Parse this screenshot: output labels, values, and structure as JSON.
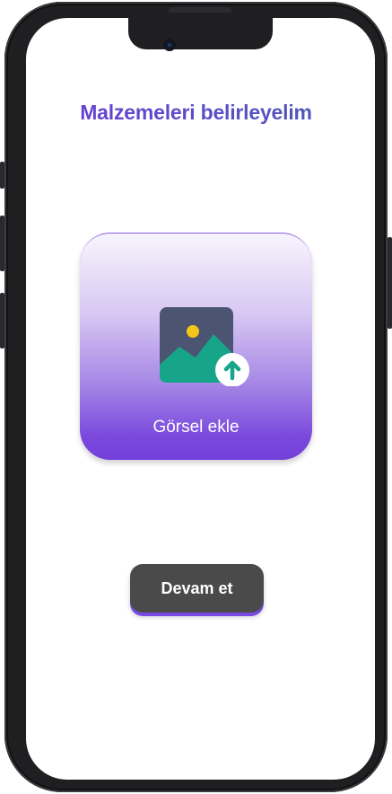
{
  "screen": {
    "title": "Malzemeleri belirleyelim"
  },
  "upload": {
    "label": "Görsel ekle",
    "icon": "image-upload-icon"
  },
  "actions": {
    "continue_label": "Devam et"
  },
  "colors": {
    "accent": "#6b3ad6",
    "card_gradient_top": "#f8f5fd",
    "card_gradient_bottom": "#7340da",
    "button_bg": "#4a4a4a",
    "icon_frame": "#4b5470",
    "icon_mountain": "#17a58a",
    "icon_sun": "#f5c518"
  }
}
